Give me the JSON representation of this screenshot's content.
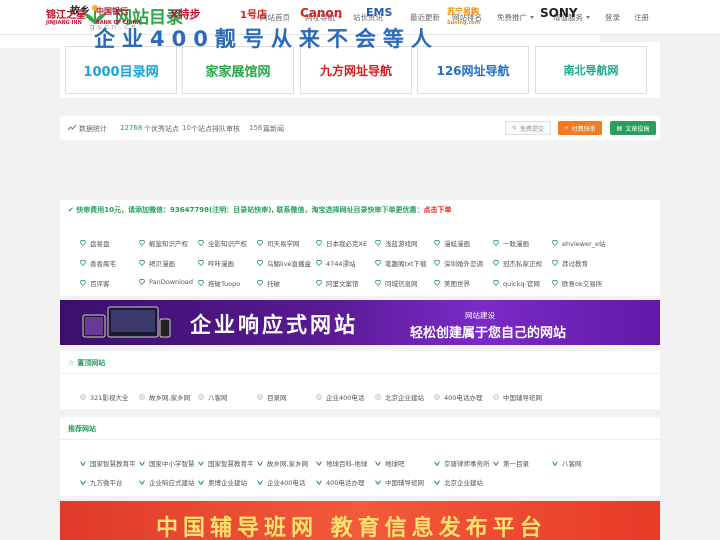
{
  "logo": {
    "mark": "故乡",
    "title": "网站目录",
    "subtitle": "gucn.cn"
  },
  "nav": [
    {
      "label": "网站首页",
      "dropdown": false
    },
    {
      "label": "网址导航",
      "dropdown": true
    },
    {
      "label": "站长资讯",
      "dropdown": false
    },
    {
      "label": "最近更新",
      "dropdown": false
    },
    {
      "label": "网站排名",
      "dropdown": false
    },
    {
      "label": "免费推广",
      "dropdown": true
    },
    {
      "label": "增值服务",
      "dropdown": true
    },
    {
      "label": "登录",
      "dropdown": false
    },
    {
      "label": "注册",
      "dropdown": false
    }
  ],
  "banners": [
    {
      "text": "1000目录网",
      "color": "#1aa3d8"
    },
    {
      "text": "家家展馆网",
      "color": "#2aa84a"
    },
    {
      "text": "九方网址导航",
      "color": "#d81e1e"
    },
    {
      "text": "126网址导航",
      "color": "#1e6fc8"
    },
    {
      "text": "南北导航网",
      "color": "#1aa58a"
    }
  ],
  "stats": {
    "label": "数据统计",
    "sites_count": "12768",
    "sites_text": "个优秀站点",
    "pending_count": "10",
    "pending_text": "个站点排队审核",
    "news_count": "156",
    "news_text": "篇新闻",
    "btn_free": "免费提交",
    "btn_paid": "付费快审",
    "btn_article": "文章投稿"
  },
  "adbar": {
    "brands": [
      "锦江之星",
      "中国银行",
      "X特步",
      "1号店",
      "Canon",
      "EMS",
      "苏宁易购",
      "SONY"
    ],
    "brand_sub": [
      "JINJIANG INN",
      "BANK OF CHINA",
      "",
      "",
      "",
      "",
      "Suning.com",
      ""
    ],
    "slogan": "企业400靓号从来不会等人"
  },
  "quick": {
    "notice_prefix": "快审费用10元，请添加微信：93647798(注明：目录站快审), 联系微信，淘宝选择网址目录快审下单更优惠：",
    "notice_link": "点击下单",
    "links": [
      "盘易盘",
      "靓鉴知识产权",
      "全影知识产权",
      "司天易学网",
      "日本我必克XE",
      "浅蓝游戏网",
      "漫蛙漫画",
      "一耽漫画",
      "ehviewer_e站",
      "香香腐宅",
      "拷贝漫画",
      "哔咔漫画",
      "乌鲳live直播盒",
      "4744漂站",
      "笔趣阁txt下载",
      "深圳婚外恋调",
      "冠杰私家正规",
      "莽过教育",
      "百评客",
      "PanDownload",
      "拖破Tuopo",
      "托破",
      "阿里文案馆",
      "同城信息网",
      "美图世界",
      "quickq-官网",
      "欧意ok交易所"
    ]
  },
  "promo": {
    "big_text": "企业响应式网站",
    "small_label": "网站建设",
    "sub_text": "轻松创建属于您自己的网站"
  },
  "pinned": {
    "title": "置顶网站",
    "links": [
      "321影视大全",
      "故乡网,家乡网",
      "八客网",
      "目录网",
      "企业400电话",
      "北京企业建站",
      "400电话办理",
      "中国辅导班网"
    ]
  },
  "recommended": {
    "title": "推荐网站",
    "links": [
      "国家智慧教育平",
      "国家中小学智慧",
      "国家智慧教育平",
      "故乡网,家乡网",
      "地球百科-地球",
      "地球吧",
      "京唐律师事务所",
      "第一目录",
      "八客网",
      "九方微平台",
      "企业响应式建站",
      "奥博企业建站",
      "企业400电话",
      "400电话办理",
      "中国辅导班网",
      "北京企业建站"
    ]
  },
  "bottom_ad": {
    "text": "中国辅导班网 教育信息发布平台"
  },
  "colors": {
    "accent": "#2a9d5c",
    "paid_btn": "#f47a20",
    "article_btn": "#2a9d5c",
    "alert": "#e02020"
  }
}
